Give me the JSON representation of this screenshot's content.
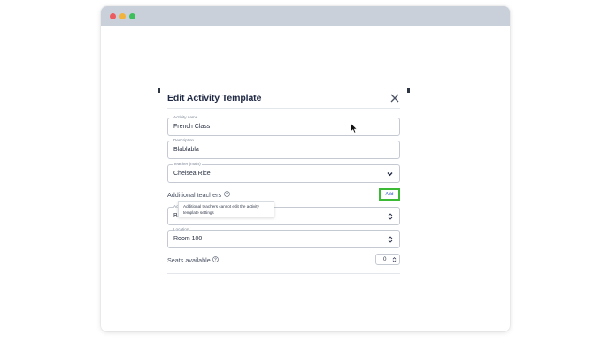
{
  "window": {
    "controls": [
      "close-dot",
      "minimize-dot",
      "maximize-dot"
    ]
  },
  "modal": {
    "title": "Edit Activity Template",
    "close_icon": "close-icon",
    "fields": {
      "activity_name": {
        "label": "Activity name",
        "value": "French Class"
      },
      "description": {
        "label": "Description",
        "value": "Blablabla"
      },
      "teacher_main": {
        "label": "Teacher (main)",
        "value": "Chelsea Rice"
      },
      "additional_teachers": {
        "label": "Additional teachers",
        "add_label": "Add"
      },
      "tooltip": {
        "text": "Additional teachers cannot edit the activity template settings"
      },
      "obscured_field": {
        "label": "Ac",
        "value": "Blabla"
      },
      "location": {
        "label": "Location",
        "value": "Room 100"
      },
      "seats_available": {
        "label": "Seats available",
        "value": "0"
      }
    }
  },
  "colors": {
    "titlebar": "#c9d0da",
    "add_highlight": "#3dba35",
    "link_blue": "#3558c9",
    "title_text": "#222b45"
  }
}
